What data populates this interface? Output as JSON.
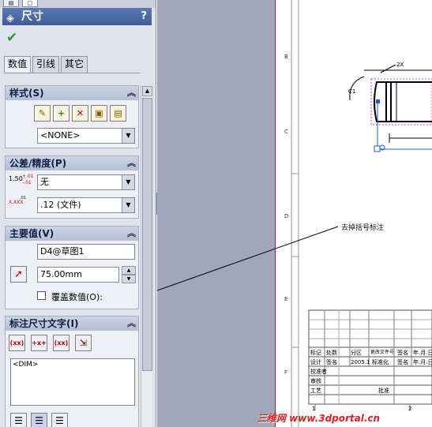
{
  "panel": {
    "title": "尺寸",
    "help": "?",
    "tabs": [
      "数值",
      "引线",
      "其它"
    ],
    "style_group": {
      "title": "样式(S)",
      "style_select": "<NONE>"
    },
    "tolerance_group": {
      "title": "公差/精度(P)",
      "tol_icon_base": "1.50",
      "tol_icon_plus": "+.01",
      "tol_icon_minus": "-.01",
      "tolerance_select": "无",
      "precision_icon_main": "X.XXX",
      "precision_icon_sup": ".01",
      "precision_select": ".12 (文件)"
    },
    "primary_group": {
      "title": "主要值(V)",
      "name_value": "D4@草图1",
      "dim_value": "75.00mm",
      "override_label": "覆盖数值(O):"
    },
    "dimtext_group": {
      "title": "标注尺寸文字(I)",
      "btn_labels": [
        "(xx)",
        "+x+",
        "(xx)",
        ""
      ],
      "text_value": "<DIM>"
    },
    "collapse": "«"
  },
  "drawing": {
    "row_labels": [
      "B",
      "C",
      "D",
      "E",
      "F"
    ],
    "annotation": "去掉括号标注",
    "title_block": {
      "row1": [
        "标记",
        "处数",
        "分区",
        "更改文件号",
        "签名",
        "年.月.日"
      ],
      "row2": [
        "设计",
        "签名",
        "2005.1",
        "标准化",
        "签名",
        "年.月.日"
      ],
      "row3": "校准者",
      "row4": "审核",
      "row5": [
        "工艺",
        "",
        "批准"
      ],
      "bottom": [
        "1",
        "2"
      ]
    },
    "dim_labels": [
      "2X",
      "C1"
    ]
  },
  "watermark": "三维网 www.3dportal.cn",
  "colors": {
    "accent_titlebar": "#4a6aa7",
    "sheet_border": "#7a2080",
    "selection": "#d040d0",
    "dim_blue": "#1a5fd0",
    "watermark": "#e02020",
    "ok_green": "#2e9a2a"
  }
}
